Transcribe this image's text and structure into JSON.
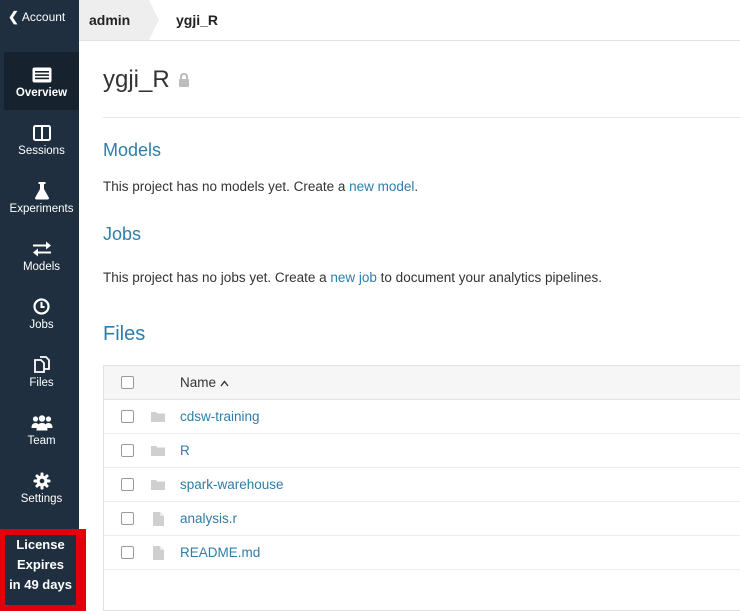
{
  "account": {
    "label": "Account"
  },
  "sidebar": {
    "items": [
      {
        "label": "Overview",
        "icon": "overview-icon"
      },
      {
        "label": "Sessions",
        "icon": "sessions-icon"
      },
      {
        "label": "Experiments",
        "icon": "flask-icon"
      },
      {
        "label": "Models",
        "icon": "arrows-icon"
      },
      {
        "label": "Jobs",
        "icon": "clock-icon"
      },
      {
        "label": "Files",
        "icon": "files-icon"
      },
      {
        "label": "Team",
        "icon": "team-icon"
      },
      {
        "label": "Settings",
        "icon": "gear-icon"
      }
    ]
  },
  "license": {
    "line1": "License",
    "line2": "Expires",
    "line3": "in 49 days"
  },
  "breadcrumb": {
    "user": "admin",
    "project": "ygji_R"
  },
  "project": {
    "title": "ygji_R"
  },
  "models": {
    "heading": "Models",
    "text_before": "This project has no models yet. Create a ",
    "link": "new model",
    "text_after": "."
  },
  "jobs": {
    "heading": "Jobs",
    "text_before": "This project has no jobs yet. Create a ",
    "link": "new job",
    "text_after": " to document your analytics pipelines."
  },
  "files": {
    "heading": "Files",
    "column_name": "Name",
    "sort_icon": "caret-up-icon",
    "rows": [
      {
        "name": "cdsw-training",
        "type": "folder"
      },
      {
        "name": "R",
        "type": "folder"
      },
      {
        "name": "spark-warehouse",
        "type": "folder"
      },
      {
        "name": "analysis.r",
        "type": "file"
      },
      {
        "name": "README.md",
        "type": "file"
      }
    ]
  },
  "colors": {
    "sidebar": "#1f2f3f",
    "link": "#2e7ea8",
    "highlight": "#e0000e"
  }
}
